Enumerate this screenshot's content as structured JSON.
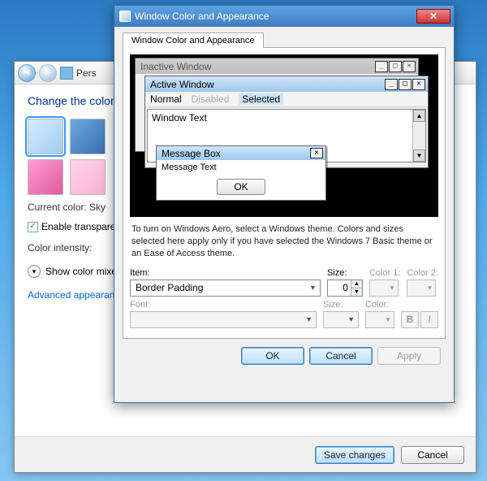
{
  "parent": {
    "addr": "Pers",
    "title": "Change the color",
    "current_color_label": "Current color:",
    "current_color_value": "Sky",
    "transparency_label": "Enable transparenc",
    "intensity_label": "Color intensity:",
    "mixer_label": "Show color mixer",
    "advanced_link": "Advanced appearance",
    "save_btn": "Save changes",
    "cancel_btn": "Cancel"
  },
  "dialog": {
    "window_title": "Window Color and Appearance",
    "tab_label": "Window Color and Appearance",
    "preview": {
      "inactive_title": "Inactive Window",
      "active_title": "Active Window",
      "menu_normal": "Normal",
      "menu_disabled": "Disabled",
      "menu_selected": "Selected",
      "window_text": "Window Text",
      "msgbox_title": "Message Box",
      "msgbox_text": "Message Text",
      "msgbox_ok": "OK"
    },
    "description": "To turn on Windows Aero, select a Windows theme.  Colors and sizes selected here apply only if you have selected the Windows 7 Basic theme or an Ease of Access theme.",
    "item_label": "Item:",
    "item_value": "Border Padding",
    "size_label": "Size:",
    "size_value": "0",
    "color1_label": "Color 1:",
    "color2_label": "Color 2:",
    "font_label": "Font:",
    "fsize_label": "Size:",
    "fcolor_label": "Color:",
    "bold": "B",
    "italic": "I",
    "ok_btn": "OK",
    "cancel_btn": "Cancel",
    "apply_btn": "Apply"
  }
}
